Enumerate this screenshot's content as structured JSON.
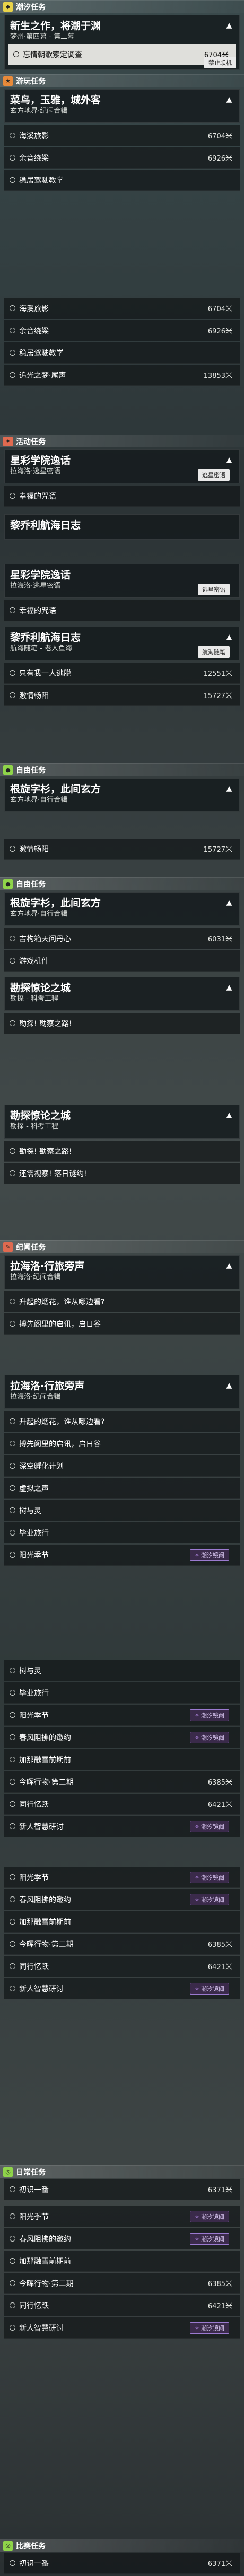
{
  "sections": {
    "chaoxi": "潮汐任务",
    "youxi": "游玩任务",
    "huodong": "活动任务",
    "ziyou": "自由任务",
    "jiyuan": "纪闻任务",
    "riyu": "日常任务",
    "bihai": "比赛任务"
  },
  "quests": {
    "q1": {
      "title": "新生之作，将潮于渊",
      "sub": "梦州·第四幕 - 第二幕"
    },
    "q2": {
      "title": "菜鸟，玉雅，城外客",
      "sub": "玄方地界·纪闻合辑"
    },
    "q3": {
      "title": "星彩学院逸话",
      "sub": "拉海洛·逃星密语"
    },
    "q4": {
      "title": "黎乔利航海日志",
      "sub": ""
    },
    "q5": {
      "title": "星彩学院逸话",
      "sub": "拉海洛·逃星密语"
    },
    "q6": {
      "title": "黎乔利航海日志",
      "sub": "航海随笔 - 老人鱼海"
    },
    "q7": {
      "title": "根旋字杉，此间玄方",
      "sub": "玄方地界·自行合辑"
    },
    "q8": {
      "title": "根旋字杉，此间玄方",
      "sub": "玄方地界·自行合辑"
    },
    "q9": {
      "title": "勘探惊论之城",
      "sub": "勘探 - 科考工程"
    },
    "q10": {
      "title": "勘探惊论之城",
      "sub": "勘探 - 科考工程"
    },
    "q11": {
      "title": "拉海洛·行旅旁声",
      "sub": "拉海洛·纪闻合辑"
    },
    "q12": {
      "title": "拉海洛·行旅旁声",
      "sub": "拉海洛·纪闻合辑"
    }
  },
  "objs": {
    "o1": {
      "label": "忘情朝歌索定调查",
      "dist": "6704米"
    },
    "o2": {
      "label": "海溪旅影",
      "dist": "6704米"
    },
    "o3": {
      "label": "余音绕梁",
      "dist": "6926米"
    },
    "o4": {
      "label": "稳居驾驶教学",
      "dist": ""
    },
    "o5": {
      "label": "海溪旅影",
      "dist": "6704米"
    },
    "o6": {
      "label": "余音绕梁",
      "dist": "6926米"
    },
    "o7": {
      "label": "稳居驾驶教学",
      "dist": ""
    },
    "o8": {
      "label": "追光之梦·尾声",
      "dist": "13853米"
    },
    "o9": {
      "label": "幸福的咒语",
      "dist": ""
    },
    "o10": {
      "label": "幸福的咒语",
      "dist": ""
    },
    "o11": {
      "label": "只有我一人逃脱",
      "dist": "12551米"
    },
    "o12": {
      "label": "激情畅阳",
      "dist": "15727米"
    },
    "o13": {
      "label": "激情畅阳",
      "dist": "15727米"
    },
    "o14": {
      "label": "吉构箱天问丹心",
      "dist": "6031米"
    },
    "o15": {
      "label": "游戏机件",
      "dist": ""
    },
    "o16": {
      "label": "勘探! 勘察之路!",
      "dist": ""
    },
    "o17": {
      "label": "勘探! 勘察之路!",
      "dist": ""
    },
    "o18": {
      "label": "还需视察! 落日谜约!",
      "dist": ""
    },
    "o19": {
      "label": "升起的烟花，谁从哪边看?",
      "dist": ""
    },
    "o20": {
      "label": "搏先阁里的启讯，启日谷",
      "dist": ""
    },
    "o21": {
      "label": "升起的烟花，谁从哪边看?",
      "dist": ""
    },
    "o22": {
      "label": "搏先阁里的启讯，启日谷",
      "dist": ""
    },
    "o23": {
      "label": "深空孵化计划",
      "dist": ""
    },
    "o24": {
      "label": "虚拟之声",
      "dist": ""
    },
    "o25": {
      "label": "树与灵",
      "dist": ""
    },
    "o26": {
      "label": "毕业旅行",
      "dist": ""
    },
    "o27": {
      "label": "阳光季节",
      "dist": ""
    },
    "o28": {
      "label": "树与灵",
      "dist": ""
    },
    "o29": {
      "label": "毕业旅行",
      "dist": ""
    },
    "o30": {
      "label": "阳光季节",
      "dist": ""
    },
    "o31": {
      "label": "春风阻拂的邀约",
      "dist": ""
    },
    "o32": {
      "label": "加那融雪前期前",
      "dist": ""
    },
    "o33": {
      "label": "今晖行物·第二期",
      "dist": "6385米"
    },
    "o34": {
      "label": "同行忆跃",
      "dist": "6421米"
    },
    "o35": {
      "label": "新人智慧研讨",
      "dist": ""
    },
    "o36": {
      "label": "阳光季节",
      "dist": ""
    },
    "o37": {
      "label": "春风阻拂的邀约",
      "dist": ""
    },
    "o38": {
      "label": "加那融雪前期前",
      "dist": ""
    },
    "o39": {
      "label": "今晖行物·第二期",
      "dist": "6385米"
    },
    "o40": {
      "label": "同行忆跃",
      "dist": "6421米"
    },
    "o41": {
      "label": "新人智慧研讨",
      "dist": ""
    },
    "o42": {
      "label": "初识一番",
      "dist": "6371米"
    },
    "o43": {
      "label": "阳光季节",
      "dist": ""
    },
    "o44": {
      "label": "春风阻拂的邀约",
      "dist": ""
    },
    "o45": {
      "label": "加那融雪前期前",
      "dist": ""
    },
    "o46": {
      "label": "今晖行物·第二期",
      "dist": "6385米"
    },
    "o47": {
      "label": "同行忆跃",
      "dist": "6421米"
    },
    "o48": {
      "label": "新人智慧研讨",
      "dist": ""
    },
    "o49": {
      "label": "初识一番",
      "dist": "6371米"
    }
  },
  "pills": {
    "p1": "禁止联机",
    "p2": "逃星密语",
    "p3": "逃星密语",
    "p4": "航海随笔"
  },
  "tags": {
    "t1": "潮汐镜阈"
  }
}
